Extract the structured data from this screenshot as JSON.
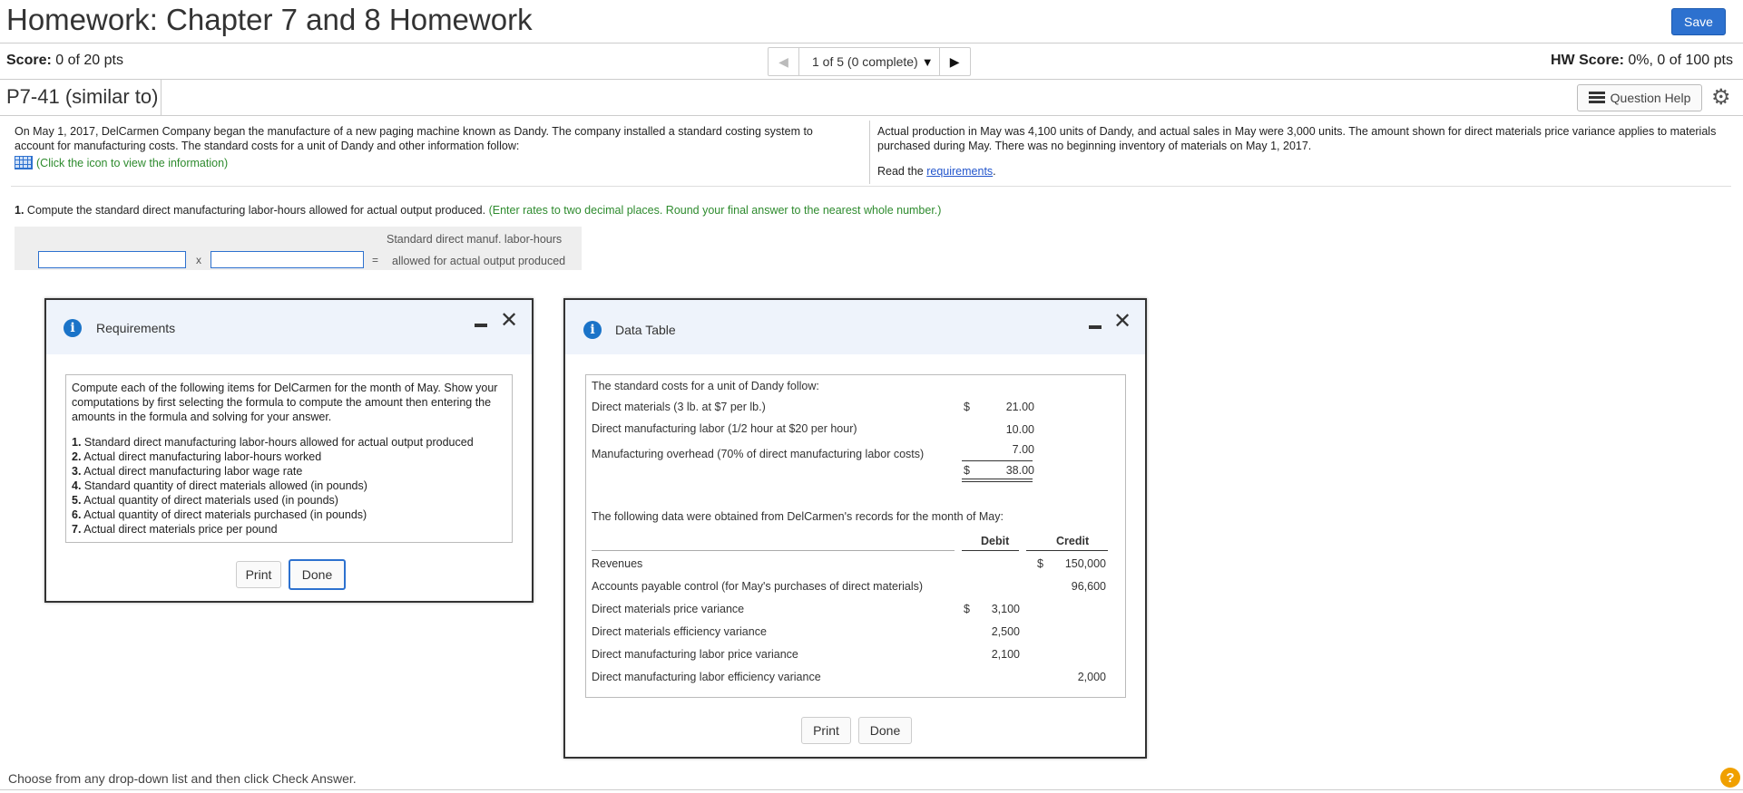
{
  "header": {
    "title": "Homework: Chapter 7 and 8 Homework",
    "save_label": "Save"
  },
  "score": {
    "label": "Score:",
    "value": "0 of 20 pts",
    "pager_text": "1 of 5 (0 complete)",
    "hw_label": "HW Score:",
    "hw_value": "0%, 0 of 100 pts"
  },
  "question_bar": {
    "title": "P7-41 (similar to)",
    "help_label": "Question Help"
  },
  "intro": {
    "left_text": "On May 1, 2017, DelCarmen Company began the manufacture of a new paging machine known as Dandy. The company installed a standard costing system to account for manufacturing costs. The standard costs for a unit of Dandy and other information follow:",
    "info_link": "(Click the icon to view the information)",
    "right_text": "Actual production in May was 4,100 units of Dandy, and actual sales in May were 3,000 units. The amount shown for direct materials price variance applies to materials purchased during May. There was no beginning inventory of materials on May 1, 2017.",
    "read_prefix": "Read the",
    "read_link": "requirements",
    "read_suffix": "."
  },
  "question": {
    "number": "1.",
    "text": "Compute the standard direct manufacturing labor-hours allowed for actual output produced.",
    "instruction": "(Enter rates to two decimal places. Round your final answer to the nearest whole number.)"
  },
  "formula": {
    "times": "x",
    "equals": "=",
    "label_line1": "Standard direct manuf. labor-hours",
    "label_line2": "allowed for actual output produced",
    "input1": "",
    "input2": ""
  },
  "requirements_dialog": {
    "title": "Requirements",
    "intro": "Compute each of the following items for DelCarmen for the month of May. Show your computations by first selecting the formula to compute the amount then entering the amounts in the formula and solving for your answer.",
    "items": [
      {
        "num": "1.",
        "text": "Standard direct manufacturing labor-hours allowed for actual output produced"
      },
      {
        "num": "2.",
        "text": "Actual direct manufacturing labor-hours worked"
      },
      {
        "num": "3.",
        "text": "Actual direct manufacturing labor wage rate"
      },
      {
        "num": "4.",
        "text": "Standard quantity of direct materials allowed (in pounds)"
      },
      {
        "num": "5.",
        "text": "Actual quantity of direct materials used (in pounds)"
      },
      {
        "num": "6.",
        "text": "Actual quantity of direct materials purchased (in pounds)"
      },
      {
        "num": "7.",
        "text": "Actual direct materials price per pound"
      }
    ],
    "print_label": "Print",
    "done_label": "Done"
  },
  "data_dialog": {
    "title": "Data Table",
    "std_heading": "The standard costs for a unit of Dandy follow:",
    "std_rows": [
      {
        "label": "Direct materials (3 lb. at $7 per lb.)",
        "cur": "$",
        "value": "21.00"
      },
      {
        "label": "Direct manufacturing labor (1/2 hour at $20 per hour)",
        "cur": "",
        "value": "10.00"
      },
      {
        "label": "Manufacturing overhead (70% of direct manufacturing labor costs)",
        "cur": "",
        "value": "7.00"
      }
    ],
    "std_total": {
      "cur": "$",
      "value": "38.00"
    },
    "records_heading": "The following data were obtained from DelCarmen's records for the month of May:",
    "col_debit": "Debit",
    "col_credit": "Credit",
    "records": [
      {
        "label": "Revenues",
        "debit_cur": "",
        "debit": "",
        "credit_cur": "$",
        "credit": "150,000"
      },
      {
        "label": "Accounts payable control (for May's purchases of direct materials)",
        "debit_cur": "",
        "debit": "",
        "credit_cur": "",
        "credit": "96,600"
      },
      {
        "label": "Direct materials price variance",
        "debit_cur": "$",
        "debit": "3,100",
        "credit_cur": "",
        "credit": ""
      },
      {
        "label": "Direct materials efficiency variance",
        "debit_cur": "",
        "debit": "2,500",
        "credit_cur": "",
        "credit": ""
      },
      {
        "label": "Direct manufacturing labor price variance",
        "debit_cur": "",
        "debit": "2,100",
        "credit_cur": "",
        "credit": ""
      },
      {
        "label": "Direct manufacturing labor efficiency variance",
        "debit_cur": "",
        "debit": "",
        "credit_cur": "",
        "credit": "2,000"
      }
    ],
    "print_label": "Print",
    "done_label": "Done"
  },
  "footer": {
    "status": "Choose from any drop-down list and then click Check Answer.",
    "help_glyph": "?"
  },
  "colors": {
    "accent": "#2d71cf",
    "instruction_green": "#2e8b2e",
    "info_blue": "#1a73c8"
  }
}
